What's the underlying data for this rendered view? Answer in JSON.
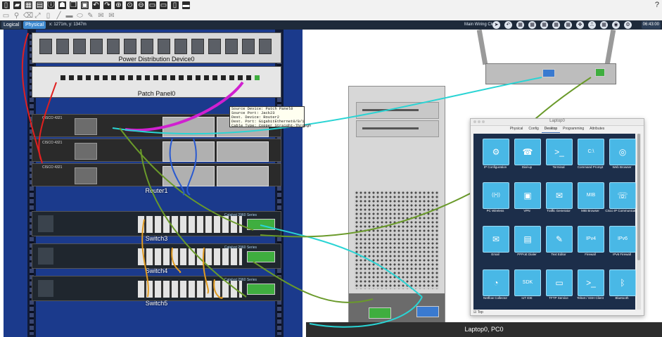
{
  "help_icon": "?",
  "toolbar_top": {
    "icons": [
      "new-file-icon",
      "open-icon",
      "save-icon",
      "print-icon",
      "info-icon",
      "user-profile-icon",
      "copy-icon",
      "paste-icon",
      "undo-icon",
      "redo-icon",
      "zoom-in-icon",
      "zoom-reset-icon",
      "zoom-out-icon",
      "palette-icon",
      "window-icon",
      "notes-icon",
      "layers-icon"
    ]
  },
  "toolbar_second": {
    "icons": [
      "select-icon",
      "inspect-icon",
      "delete-icon",
      "resize-icon",
      "notes-icon",
      "line-icon",
      "rectangle-icon",
      "ellipse-icon",
      "freeform-icon",
      "add-pdu-icon",
      "add-complex-pdu-icon"
    ]
  },
  "modebar": {
    "logical_label": "Logical",
    "physical_label": "Physical",
    "coords": "x: 1271m, y: 1347m",
    "cloud_label": "Main Wiring Closet",
    "clock": "06:43:00",
    "nav_icons": [
      "navigation-icon",
      "back-icon",
      "city-icon",
      "building-icon",
      "closet-icon",
      "rack-icon",
      "table-icon",
      "move-icon",
      "cable-icon",
      "grid-icon",
      "wireless-icon",
      "settings-icon"
    ]
  },
  "rack": {
    "pdu_label": "Power Distribution Device0",
    "patch_label": "Patch Panel0",
    "router_label": "Router1",
    "router_model": "CISCO 4321",
    "switches": [
      {
        "label": "Switch3",
        "brand": "Catalyst 2960 Series"
      },
      {
        "label": "Switch4",
        "brand": "Catalyst 2960 Series"
      },
      {
        "label": "Switch5",
        "brand": "Catalyst 2960 Series"
      }
    ]
  },
  "tooltip": {
    "line1": "Source Device: Patch Panel0",
    "line2": "Source Port: Jack23",
    "line3": "Dest. Device: Router2",
    "line4": "Dest. Port: GigabitEthernet0/0/1",
    "line5": "Cable Type: Copper Straight-Through"
  },
  "laptop": {
    "label": "Laptop0, PC0"
  },
  "dialog": {
    "title": "Laptop0",
    "tabs": [
      "Physical",
      "Config",
      "Desktop",
      "Programming",
      "Attributes"
    ],
    "active_tab": "Desktop",
    "apps": [
      {
        "label": "IP Configuration",
        "icon": "ip-config-icon",
        "glyph": "⚙"
      },
      {
        "label": "Dial-up",
        "icon": "dial-up-icon",
        "glyph": "☎"
      },
      {
        "label": "Terminal",
        "icon": "terminal-icon",
        "glyph": ">_"
      },
      {
        "label": "Command Prompt",
        "icon": "command-prompt-icon",
        "glyph": "C:\\"
      },
      {
        "label": "Web Browser",
        "icon": "web-browser-icon",
        "glyph": "◎"
      },
      {
        "label": "PC Wireless",
        "icon": "pc-wireless-icon",
        "glyph": "((•))"
      },
      {
        "label": "VPN",
        "icon": "vpn-icon",
        "glyph": "▣"
      },
      {
        "label": "Traffic Generator",
        "icon": "traffic-generator-icon",
        "glyph": "✉"
      },
      {
        "label": "MIB Browser",
        "icon": "mib-browser-icon",
        "glyph": "MIB"
      },
      {
        "label": "Cisco IP Communicator",
        "icon": "ip-communicator-icon",
        "glyph": "☏"
      },
      {
        "label": "Email",
        "icon": "email-icon",
        "glyph": "✉"
      },
      {
        "label": "PPPoE Dialer",
        "icon": "pppoe-dialer-icon",
        "glyph": "▤"
      },
      {
        "label": "Text Editor",
        "icon": "text-editor-icon",
        "glyph": "✎"
      },
      {
        "label": "Firewall",
        "icon": "firewall-icon",
        "glyph": "IPv4"
      },
      {
        "label": "IPv6 Firewall",
        "icon": "ipv6-firewall-icon",
        "glyph": "IPv6"
      },
      {
        "label": "Netflow Collector",
        "icon": "netflow-collector-icon",
        "glyph": "◔"
      },
      {
        "label": "IoT IDE",
        "icon": "iot-ide-icon",
        "glyph": "SDK"
      },
      {
        "label": "TFTP Service",
        "icon": "tftp-service-icon",
        "glyph": "▭"
      },
      {
        "label": "Telnet / SSH Client",
        "icon": "telnet-ssh-icon",
        "glyph": ">_"
      },
      {
        "label": "Bluetooth",
        "icon": "bluetooth-icon",
        "glyph": "ᛒ"
      }
    ],
    "top_checkbox": "Top"
  },
  "colors": {
    "rack_blue": "#1b3a8c",
    "cable_magenta": "#d020d0",
    "cable_cyan": "#2ad4d4",
    "cable_green": "#6a9a2a",
    "cable_red": "#e02020",
    "cable_orange": "#e09a20",
    "cable_blue": "#2a5ad0"
  }
}
